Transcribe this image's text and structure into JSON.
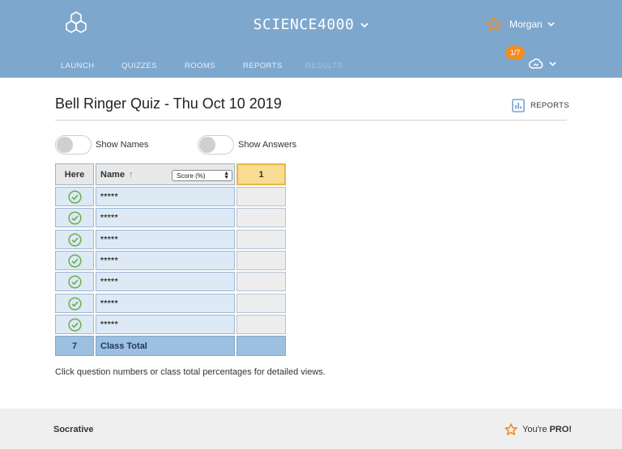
{
  "header": {
    "room_name": "SCIENCE4000",
    "user_name": "Morgan",
    "notification_badge": "1/7",
    "nav": [
      {
        "label": "LAUNCH"
      },
      {
        "label": "QUIZZES"
      },
      {
        "label": "ROOMS"
      },
      {
        "label": "REPORTS"
      },
      {
        "label": "RESULTS"
      }
    ]
  },
  "quiz": {
    "title": "Bell Ringer Quiz - Thu Oct 10 2019",
    "reports_label": "REPORTS"
  },
  "toggles": {
    "show_names": "Show Names",
    "show_answers": "Show Answers"
  },
  "table": {
    "here_header": "Here",
    "name_header": "Name",
    "score_select": "Score (%)",
    "question_header": "1",
    "rows": [
      {
        "name": "*****"
      },
      {
        "name": "*****"
      },
      {
        "name": "*****"
      },
      {
        "name": "*****"
      },
      {
        "name": "*****"
      },
      {
        "name": "*****"
      },
      {
        "name": "*****"
      }
    ],
    "total_count": "7",
    "total_label": "Class Total"
  },
  "hint": "Click question numbers or class total percentages for detailed views.",
  "footer": {
    "brand": "Socrative",
    "pro_prefix": "You're",
    "pro_label": "PRO!"
  },
  "icons": {
    "logo": "hexagon-molecule-icon",
    "user": "star-icon",
    "cloud": "cloud-icon",
    "reports": "bar-chart-icon",
    "present": "check-circle-icon"
  },
  "colors": {
    "header_bg": "#7ea7cd",
    "accent_orange": "#f28c1e",
    "check_green": "#6ab04c",
    "question_highlight": "#f7dc92",
    "total_row": "#9dbfe0"
  }
}
